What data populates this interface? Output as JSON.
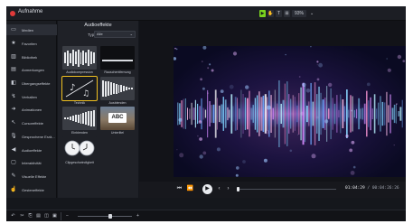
{
  "app": {
    "title": "Aufnahme"
  },
  "toolbar": {
    "tools": [
      "▶",
      "✋",
      "T",
      "⊞"
    ],
    "zoom": "93%",
    "dropdown": "⌄"
  },
  "sidebar": {
    "items": [
      {
        "label": "Medien",
        "icon": "media-icon",
        "glyph": "▭"
      },
      {
        "label": "Favoriten",
        "icon": "star-icon",
        "glyph": "★"
      },
      {
        "label": "Bibliothek",
        "icon": "library-icon",
        "glyph": "▥"
      },
      {
        "label": "Anmerkungen",
        "icon": "annotation-icon",
        "glyph": "▤"
      },
      {
        "label": "Übergangseffekte",
        "icon": "transition-icon",
        "glyph": "◧"
      },
      {
        "label": "Verhalten",
        "icon": "behavior-icon",
        "glyph": "↯"
      },
      {
        "label": "Animationen",
        "icon": "animation-icon",
        "glyph": "➜"
      },
      {
        "label": "Cursoreffekte",
        "icon": "cursor-icon",
        "glyph": "↖"
      },
      {
        "label": "Gesprochene Erzä...",
        "icon": "microphone-icon",
        "glyph": "🎙"
      },
      {
        "label": "Audioeffekte",
        "icon": "audio-effects-icon",
        "glyph": "◀"
      },
      {
        "label": "Interaktivität",
        "icon": "interactivity-icon",
        "glyph": "▢"
      },
      {
        "label": "Visuelle Effekte",
        "icon": "visual-effects-icon",
        "glyph": "✎"
      },
      {
        "label": "Gesteneffekte",
        "icon": "gesture-icon",
        "glyph": "☝"
      }
    ]
  },
  "panel": {
    "title": "Audioeffekte",
    "filter_label": "Typ",
    "filter_value": "Alle",
    "effects": [
      {
        "label": "Audiokompression"
      },
      {
        "label": "Rauschentfernung"
      },
      {
        "label": "Technik"
      },
      {
        "label": "Ausblenden"
      },
      {
        "label": "Einblenden"
      },
      {
        "label": "Unterlitel"
      },
      {
        "label": "Clipgeschwindigkeit"
      }
    ],
    "thumb_text": "ABC"
  },
  "player": {
    "timecode_current": "01:04:29",
    "timecode_rest": "00:04:26:26"
  }
}
